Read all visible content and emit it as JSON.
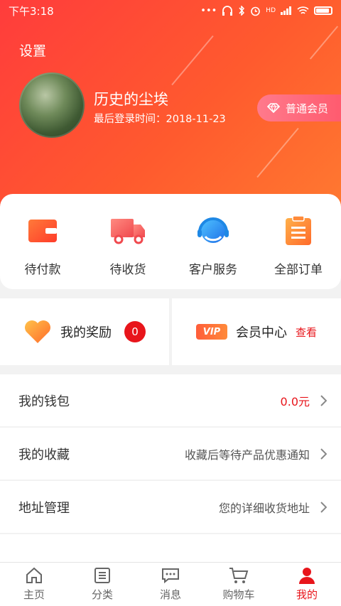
{
  "status_bar": {
    "time": "下午3:18",
    "signal_text": "HD"
  },
  "header": {
    "settings_label": "设置",
    "username": "历史的尘埃",
    "last_login": "最后登录时间：2018-11-23",
    "member_level": "普通会员"
  },
  "orders": [
    {
      "label": "待付款",
      "icon": "wallet-icon"
    },
    {
      "label": "待收货",
      "icon": "truck-icon"
    },
    {
      "label": "客户服务",
      "icon": "headset-icon"
    },
    {
      "label": "全部订单",
      "icon": "clipboard-icon"
    }
  ],
  "rewards": {
    "label": "我的奖励",
    "count": "0"
  },
  "membership": {
    "vip_text": "VIP",
    "label": "会员中心",
    "action": "查看"
  },
  "list": [
    {
      "label": "我的钱包",
      "value": "0.0元"
    },
    {
      "label": "我的收藏",
      "value": "收藏后等待产品优惠通知"
    },
    {
      "label": "地址管理",
      "value": "您的详细收货地址"
    }
  ],
  "tabs": [
    {
      "label": "主页",
      "icon": "home-icon",
      "active": false
    },
    {
      "label": "分类",
      "icon": "list-icon",
      "active": false
    },
    {
      "label": "消息",
      "icon": "message-icon",
      "active": false
    },
    {
      "label": "购物车",
      "icon": "cart-icon",
      "active": false
    },
    {
      "label": "我的",
      "icon": "user-icon",
      "active": true
    }
  ],
  "colors": {
    "accent": "#e8151b",
    "header_start": "#ff3c3c",
    "header_end": "#ff7a30"
  }
}
